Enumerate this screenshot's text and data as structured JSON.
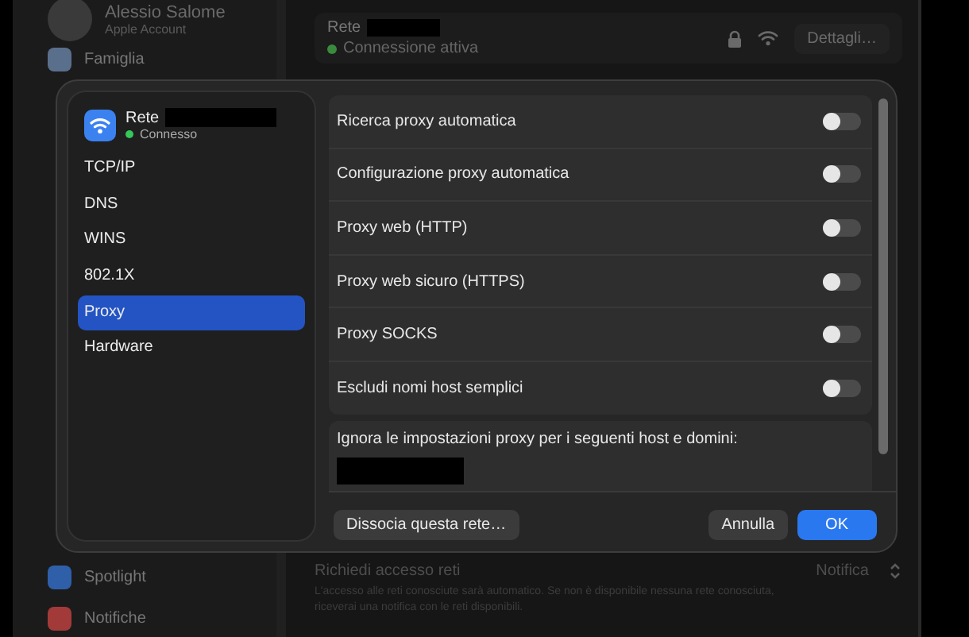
{
  "background": {
    "account": {
      "name": "Alessio Salome",
      "subtitle": "Apple Account"
    },
    "sidebar_items": [
      {
        "label": "Famiglia",
        "color": "#5a6f8c"
      },
      {
        "label": "Spotlight",
        "color": "#2f5fa8"
      },
      {
        "label": "Notifiche",
        "color": "#a33a3a"
      }
    ],
    "network": {
      "name": "Rete",
      "status": "Connessione attiva",
      "connected": true,
      "button": "Dettagli…"
    },
    "ask_to_join": {
      "title": "Richiedi accesso reti",
      "description": "L'accesso alle reti conosciute sarà automatico. Se non è disponibile nessuna rete conosciuta, riceverai una notifica con le reti disponibili.",
      "value": "Notifica"
    }
  },
  "dialog": {
    "network": {
      "name": "Rete",
      "status": "Connesso",
      "connected": true
    },
    "sidebar": [
      {
        "label": "TCP/IP",
        "selected": false
      },
      {
        "label": "DNS",
        "selected": false
      },
      {
        "label": "WINS",
        "selected": false
      },
      {
        "label": "802.1X",
        "selected": false
      },
      {
        "label": "Proxy",
        "selected": true
      },
      {
        "label": "Hardware",
        "selected": false
      }
    ],
    "proxy_options": [
      {
        "label": "Ricerca proxy automatica",
        "on": false
      },
      {
        "label": "Configurazione proxy automatica",
        "on": false
      },
      {
        "label": "Proxy web (HTTP)",
        "on": false
      },
      {
        "label": "Proxy web sicuro (HTTPS)",
        "on": false
      },
      {
        "label": "Proxy SOCKS",
        "on": false
      },
      {
        "label": "Escludi nomi host semplici",
        "on": false
      }
    ],
    "bypass": {
      "label": "Ignora le impostazioni proxy per i seguenti host e domini:"
    },
    "buttons": {
      "forget": "Dissocia questa rete…",
      "cancel": "Annulla",
      "ok": "OK"
    }
  }
}
